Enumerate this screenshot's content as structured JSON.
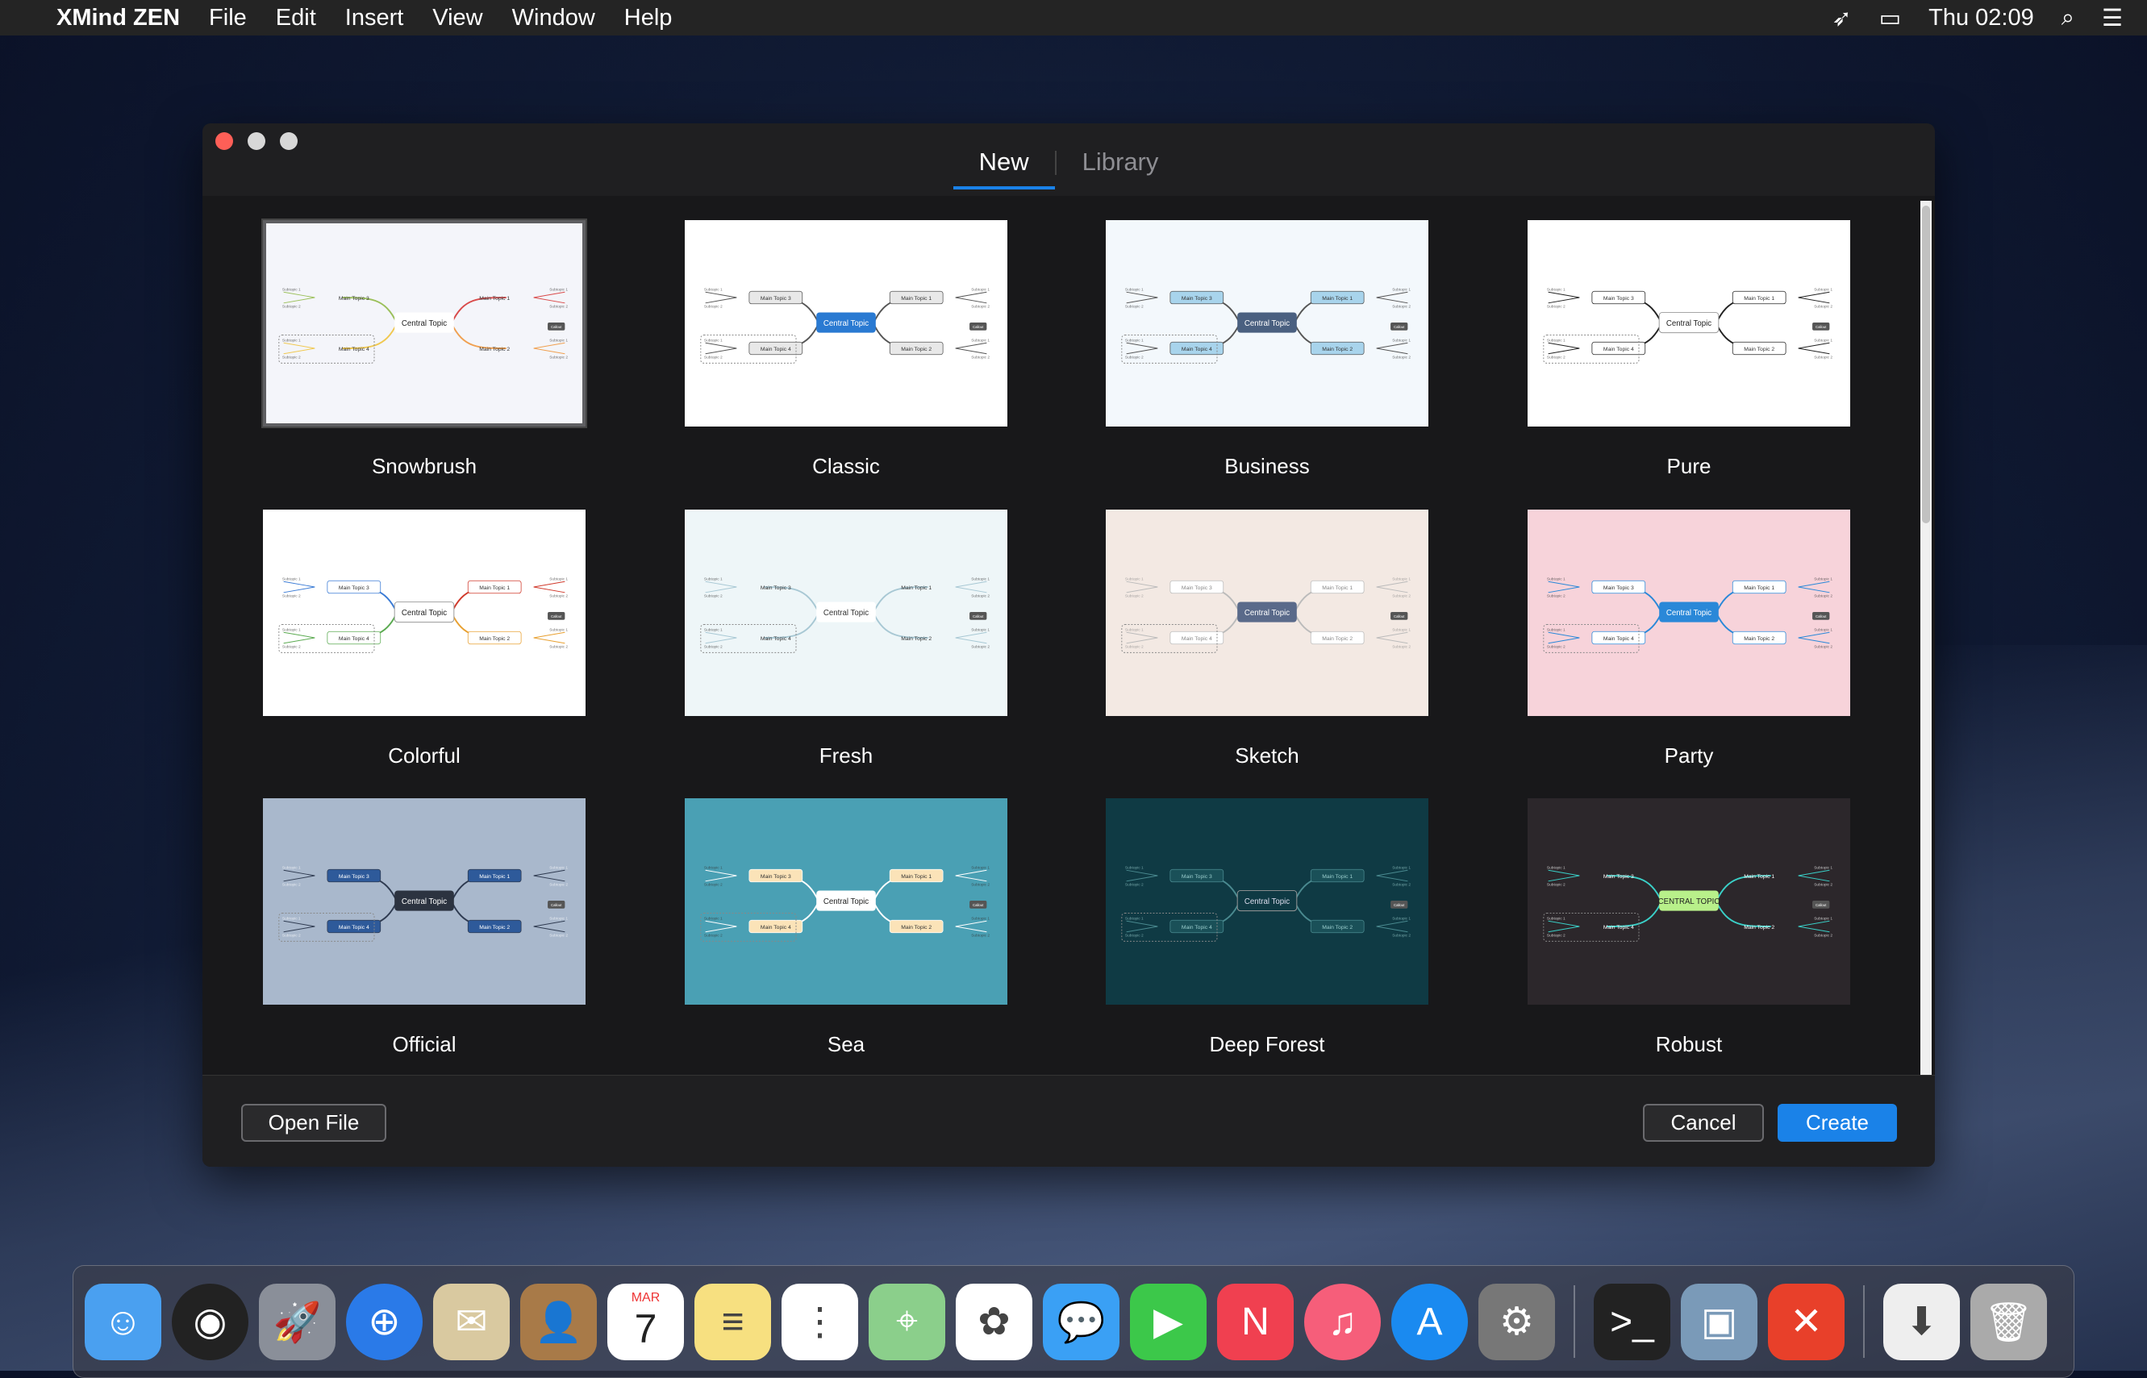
{
  "menubar": {
    "app": "XMind ZEN",
    "items": [
      "File",
      "Edit",
      "Insert",
      "View",
      "Window",
      "Help"
    ],
    "clock": "Thu 02:09"
  },
  "tabs": [
    {
      "label": "New",
      "active": true
    },
    {
      "label": "Library",
      "active": false
    }
  ],
  "thumb_text": {
    "central": "Central Topic",
    "central_caps": "CENTRAL TOPIC",
    "m1": "Main Topic 1",
    "m2": "Main Topic 2",
    "m3": "Main Topic 3",
    "m4": "Main Topic 4",
    "s1": "Subtopic 1",
    "s2": "Subtopic 2",
    "callout": "Callout"
  },
  "templates": [
    {
      "name": "Snowbrush",
      "selected": true,
      "bg": "#f4f5fa",
      "cfill": "#ffffff",
      "ctext": "#222",
      "tfill": "none",
      "ttext": "#333",
      "lines": [
        "#d94a4a",
        "#f0a050",
        "#9bc05a",
        "#f0c850"
      ]
    },
    {
      "name": "Classic",
      "bg": "#ffffff",
      "cfill": "#2a7ad2",
      "ctext": "#fff",
      "tfill": "#e8e8e8",
      "ttext": "#333",
      "lines": [
        "#555",
        "#555",
        "#555",
        "#555"
      ]
    },
    {
      "name": "Business",
      "bg": "#f3f8fc",
      "cfill": "#4a6080",
      "ctext": "#fff",
      "tfill": "#a8d4ec",
      "ttext": "#333",
      "lines": [
        "#555",
        "#555",
        "#555",
        "#555"
      ]
    },
    {
      "name": "Pure",
      "bg": "#ffffff",
      "cfill": "#ffffff",
      "ctext": "#222",
      "tfill": "#ffffff",
      "ttext": "#333",
      "lines": [
        "#222",
        "#222",
        "#222",
        "#222"
      ]
    },
    {
      "name": "Colorful",
      "bg": "#ffffff",
      "cfill": "#ffffff",
      "ctext": "#222",
      "tfill": "#ffffff",
      "ttext": "#333",
      "lines": [
        "#d0392b",
        "#e8a030",
        "#3a7bd5",
        "#5aaa50"
      ]
    },
    {
      "name": "Fresh",
      "bg": "#eef6f8",
      "cfill": "#ffffff",
      "ctext": "#333",
      "tfill": "none",
      "ttext": "#333",
      "lines": [
        "#a8c8d4",
        "#a8c8d4",
        "#a8c8d4",
        "#a8c8d4"
      ]
    },
    {
      "name": "Sketch",
      "bg": "#f3e9e3",
      "cfill": "#5a6a8a",
      "ctext": "#fff",
      "tfill": "#ffffff",
      "ttext": "#888",
      "lines": [
        "#bbb",
        "#bbb",
        "#bbb",
        "#bbb"
      ]
    },
    {
      "name": "Party",
      "bg": "#f7d3da",
      "cfill": "#2a88d8",
      "ctext": "#fff",
      "tfill": "#ffffff",
      "ttext": "#333",
      "lines": [
        "#2a88d8",
        "#2a88d8",
        "#2a88d8",
        "#2a88d8"
      ]
    },
    {
      "name": "Official",
      "bg": "#a9b8cc",
      "cfill": "#2c3340",
      "ctext": "#fff",
      "tfill": "#2e5a9a",
      "ttext": "#fff",
      "lines": [
        "#2e3a50",
        "#2e3a50",
        "#2e3a50",
        "#2e3a50"
      ]
    },
    {
      "name": "Sea",
      "bg": "#4aa0b4",
      "cfill": "#ffffff",
      "ctext": "#222",
      "tfill": "#fbe3b8",
      "ttext": "#333",
      "lines": [
        "#fff",
        "#fff",
        "#fff",
        "#fff"
      ]
    },
    {
      "name": "Deep Forest",
      "bg": "#0f3a44",
      "cfill": "#0f3a44",
      "ctext": "#dde",
      "tfill": "#1a5058",
      "ttext": "#9cc",
      "lines": [
        "#4a8a90",
        "#4a8a90",
        "#4a8a90",
        "#4a8a90"
      ]
    },
    {
      "name": "Robust",
      "bg": "#2c272b",
      "cfill": "#b8f08a",
      "ctext": "#222",
      "tfill": "none",
      "ttext": "#fff",
      "lines": [
        "#3ad0c8",
        "#3ad0c8",
        "#3ad0c8",
        "#3ad0c8"
      ],
      "caps": true
    }
  ],
  "footer": {
    "open_file": "Open File",
    "cancel": "Cancel",
    "create": "Create"
  },
  "dock": [
    "finder",
    "siri",
    "launchpad",
    "safari",
    "mail",
    "contacts",
    "calendar",
    "notes",
    "reminders",
    "maps",
    "photos",
    "messages",
    "facetime",
    "news",
    "music",
    "app-store",
    "system-preferences",
    "terminal",
    "preview",
    "xmind",
    "downloads",
    "trash"
  ],
  "calendar": {
    "month": "MAR",
    "day": "7"
  },
  "accent": "#1a82e8"
}
